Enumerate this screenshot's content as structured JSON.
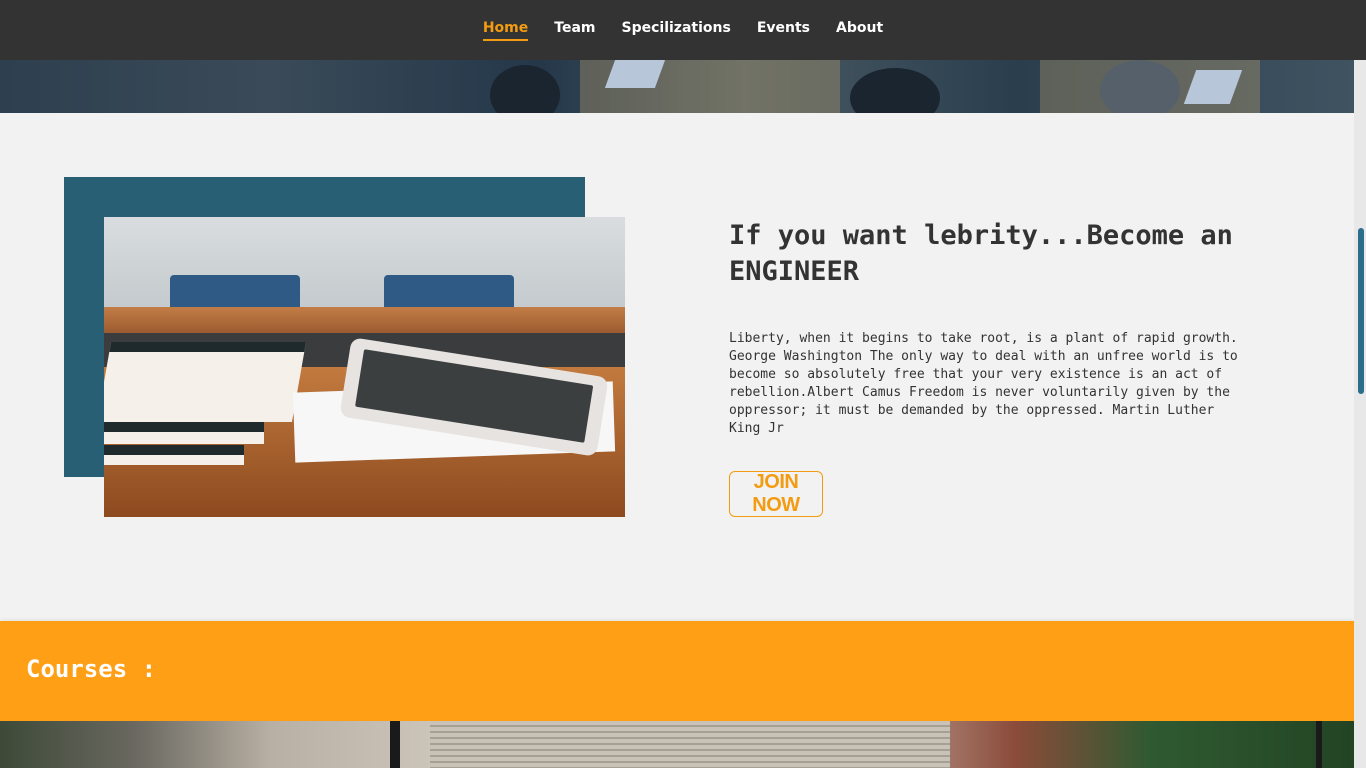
{
  "nav": {
    "items": [
      {
        "label": "Home",
        "active": true
      },
      {
        "label": "Team",
        "active": false
      },
      {
        "label": "Specilizations",
        "active": false
      },
      {
        "label": "Events",
        "active": false
      },
      {
        "label": "About",
        "active": false
      }
    ]
  },
  "about": {
    "title": "If you want lebrity...Become an ENGINEER",
    "body": "Liberty, when it begins to take root, is a plant of rapid growth. George Washington The only way to deal with an unfree world is to become so absolutely free that your very existence is an act of rebellion.Albert Camus Freedom is never voluntarily given by the oppressor; it must be demanded by the oppressed. Martin Luther King Jr",
    "cta_label": "JOIN NOW"
  },
  "courses": {
    "title": "Courses :"
  },
  "colors": {
    "navbar": "#333333",
    "accent": "#f39c12",
    "courses_bar": "#ff9f16",
    "image_frame": "#295f75",
    "background": "#f2f2f2"
  }
}
